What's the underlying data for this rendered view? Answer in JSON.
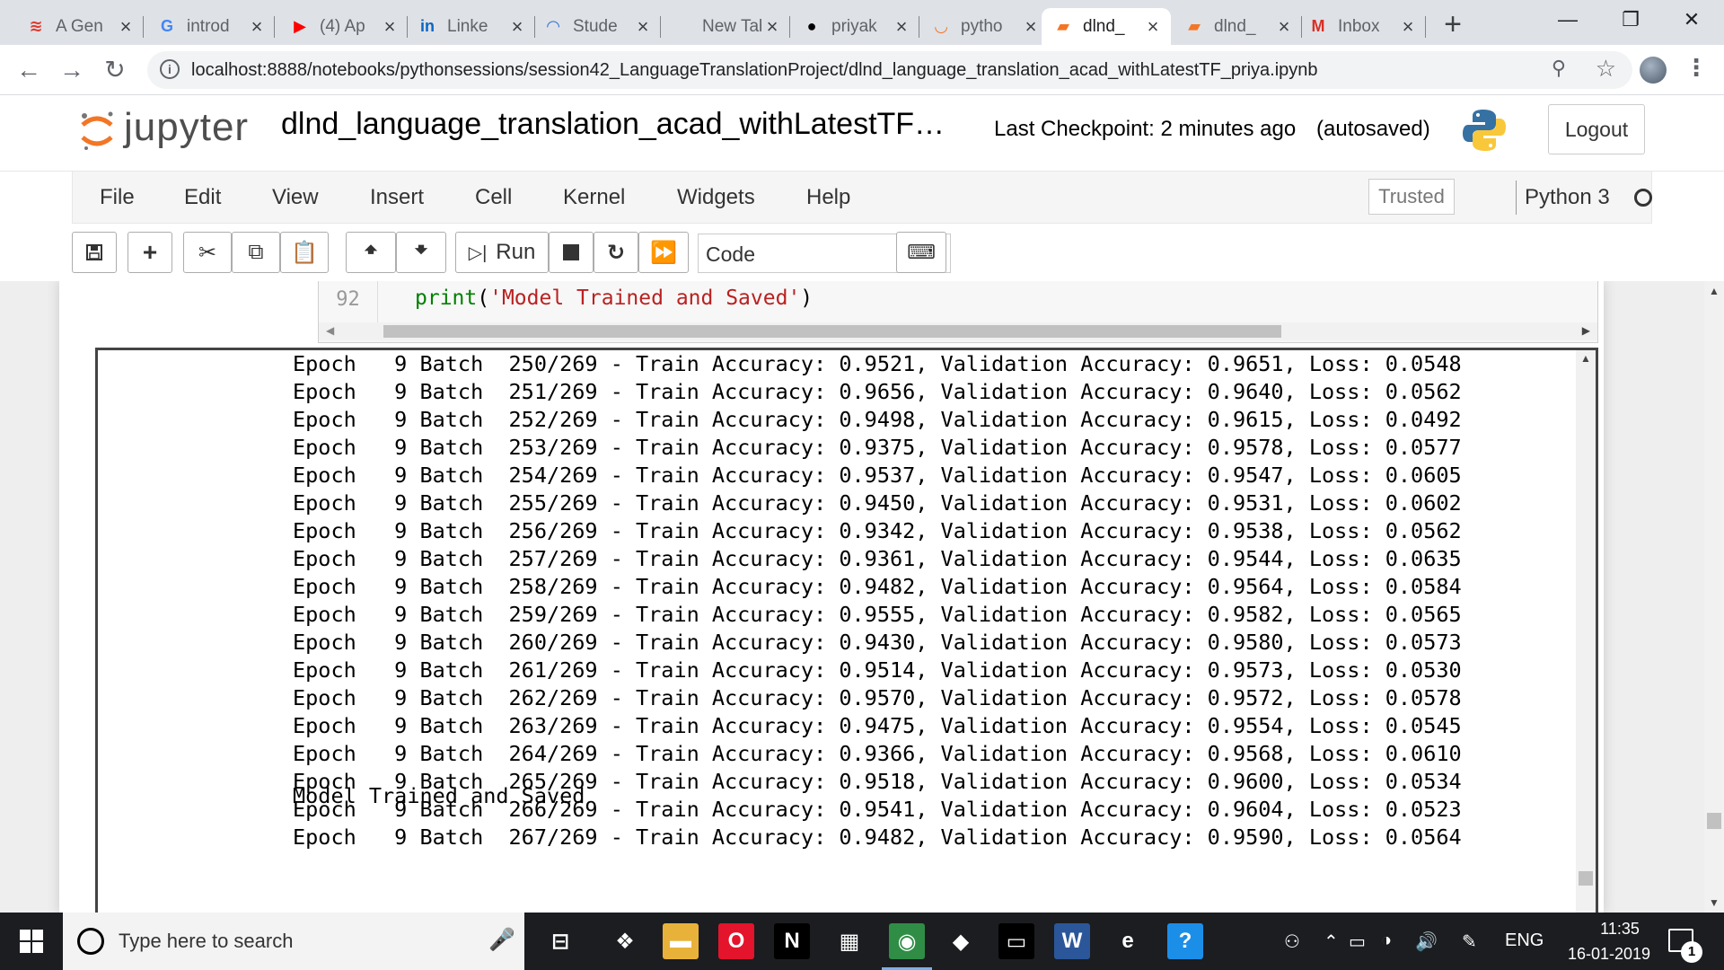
{
  "browser": {
    "tabs": [
      {
        "title": "A Gen",
        "icon": "stack-icon",
        "favicon_text": "≋",
        "favicon_color": "#e03a2f"
      },
      {
        "title": "introd",
        "icon": "google-icon",
        "favicon_text": "G",
        "favicon_color": "#4285f4"
      },
      {
        "title": "(4) Ap",
        "icon": "youtube-icon",
        "favicon_text": "▶",
        "favicon_color": "#ff0000"
      },
      {
        "title": "Linke",
        "icon": "linkedin-icon",
        "favicon_text": "in",
        "favicon_color": "#0a66c2"
      },
      {
        "title": "Stude",
        "icon": "student-portal-icon",
        "favicon_text": "◠",
        "favicon_color": "#2f6fd6"
      },
      {
        "title": "New Tab",
        "icon": "",
        "favicon_text": "",
        "favicon_color": "#5f6368"
      },
      {
        "title": "priyak",
        "icon": "github-icon",
        "favicon_text": "●",
        "favicon_color": "#000000"
      },
      {
        "title": "pytho",
        "icon": "jupyter-tab-icon",
        "favicon_text": "◡",
        "favicon_color": "#f37626"
      },
      {
        "title": "dlnd_",
        "icon": "notebook-icon",
        "favicon_text": "▰",
        "favicon_color": "#f37626"
      },
      {
        "title": "dlnd_",
        "icon": "notebook-icon",
        "favicon_text": "▰",
        "favicon_color": "#f37626"
      },
      {
        "title": "Inbox",
        "icon": "gmail-icon",
        "favicon_text": "M",
        "favicon_color": "#d93025"
      }
    ],
    "active_tab_index": 8,
    "new_tab_label": "+",
    "url": "localhost:8888/notebooks/pythonsessions/session42_LanguageTranslationProject/dlnd_language_translation_acad_withLatestTF_priya.ipynb"
  },
  "jupyter": {
    "logo_text": "jupyter",
    "notebook_name": "dlnd_language_translation_acad_withLatestTF…",
    "checkpoint": "Last Checkpoint: 2 minutes ago",
    "autosave": "(autosaved)",
    "logout_label": "Logout",
    "menu": [
      "File",
      "Edit",
      "View",
      "Insert",
      "Cell",
      "Kernel",
      "Widgets",
      "Help"
    ],
    "trusted_label": "Trusted",
    "kernel_name": "Python 3",
    "toolbar": {
      "run_label": "Run",
      "cell_type": "Code"
    },
    "code_cell": {
      "line_number": "92",
      "code_func": "print",
      "code_string": "'Model Trained and Saved'"
    },
    "output_lines": [
      "Epoch   9 Batch  250/269 - Train Accuracy: 0.9521, Validation Accuracy: 0.9651, Loss: 0.0548",
      "Epoch   9 Batch  251/269 - Train Accuracy: 0.9656, Validation Accuracy: 0.9640, Loss: 0.0562",
      "Epoch   9 Batch  252/269 - Train Accuracy: 0.9498, Validation Accuracy: 0.9615, Loss: 0.0492",
      "Epoch   9 Batch  253/269 - Train Accuracy: 0.9375, Validation Accuracy: 0.9578, Loss: 0.0577",
      "Epoch   9 Batch  254/269 - Train Accuracy: 0.9537, Validation Accuracy: 0.9547, Loss: 0.0605",
      "Epoch   9 Batch  255/269 - Train Accuracy: 0.9450, Validation Accuracy: 0.9531, Loss: 0.0602",
      "Epoch   9 Batch  256/269 - Train Accuracy: 0.9342, Validation Accuracy: 0.9538, Loss: 0.0562",
      "Epoch   9 Batch  257/269 - Train Accuracy: 0.9361, Validation Accuracy: 0.9544, Loss: 0.0635",
      "Epoch   9 Batch  258/269 - Train Accuracy: 0.9482, Validation Accuracy: 0.9564, Loss: 0.0584",
      "Epoch   9 Batch  259/269 - Train Accuracy: 0.9555, Validation Accuracy: 0.9582, Loss: 0.0565",
      "Epoch   9 Batch  260/269 - Train Accuracy: 0.9430, Validation Accuracy: 0.9580, Loss: 0.0573",
      "Epoch   9 Batch  261/269 - Train Accuracy: 0.9514, Validation Accuracy: 0.9573, Loss: 0.0530",
      "Epoch   9 Batch  262/269 - Train Accuracy: 0.9570, Validation Accuracy: 0.9572, Loss: 0.0578",
      "Epoch   9 Batch  263/269 - Train Accuracy: 0.9475, Validation Accuracy: 0.9554, Loss: 0.0545",
      "Epoch   9 Batch  264/269 - Train Accuracy: 0.9366, Validation Accuracy: 0.9568, Loss: 0.0610",
      "Epoch   9 Batch  265/269 - Train Accuracy: 0.9518, Validation Accuracy: 0.9600, Loss: 0.0534",
      "Epoch   9 Batch  266/269 - Train Accuracy: 0.9541, Validation Accuracy: 0.9604, Loss: 0.0523",
      "Epoch   9 Batch  267/269 - Train Accuracy: 0.9482, Validation Accuracy: 0.9590, Loss: 0.0564"
    ],
    "final_output": "Model Trained and Saved"
  },
  "taskbar": {
    "search_placeholder": "Type here to search",
    "apps": [
      {
        "name": "task-view-icon",
        "glyph": "⊟",
        "color": "#1b1d20"
      },
      {
        "name": "dropbox-icon",
        "glyph": "❖",
        "color": "#1b1d20"
      },
      {
        "name": "file-explorer-icon",
        "glyph": "▬",
        "color": "#e8b23a"
      },
      {
        "name": "opera-icon",
        "glyph": "O",
        "color": "#e3142b"
      },
      {
        "name": "netflix-icon",
        "glyph": "N",
        "color": "#000000"
      },
      {
        "name": "store-icon",
        "glyph": "▦",
        "color": "#1b1d20"
      },
      {
        "name": "chrome-icon",
        "glyph": "◉",
        "color": "#2f8d46"
      },
      {
        "name": "notes-icon",
        "glyph": "◆",
        "color": "#1b1d20"
      },
      {
        "name": "cmd-icon",
        "glyph": "▭",
        "color": "#000000"
      },
      {
        "name": "word-icon",
        "glyph": "W",
        "color": "#2b579a"
      },
      {
        "name": "edge-icon",
        "glyph": "e",
        "color": "#1b1d20"
      },
      {
        "name": "help-icon",
        "glyph": "?",
        "color": "#1b8ee8"
      }
    ],
    "active_app_index": 6,
    "language": "ENG",
    "time": "11:35",
    "date": "16-01-2019",
    "notification_count": "1"
  }
}
